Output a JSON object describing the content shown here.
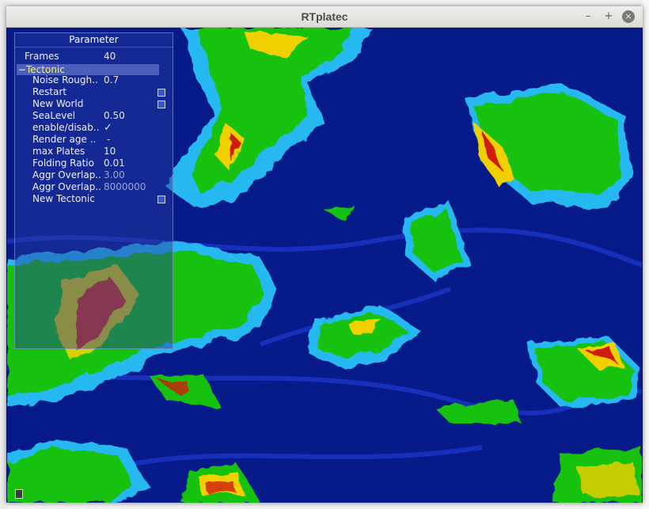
{
  "window": {
    "title": "RTplatec",
    "buttons": {
      "minimize": "–",
      "maximize": "+",
      "close": "×"
    }
  },
  "panel": {
    "title": "Parameter",
    "frames": {
      "label": "Frames",
      "value": "40"
    },
    "group": {
      "label": "Tectonic",
      "toggle": "−"
    },
    "items": [
      {
        "label": "Noise Rough..",
        "value": "0.7"
      },
      {
        "label": "Restart",
        "checkbox": true
      },
      {
        "label": "New World",
        "checkbox": true
      },
      {
        "label": "SeaLevel",
        "value": "0.50"
      },
      {
        "label": "enable/disab..",
        "value": "✓"
      },
      {
        "label": "Render age ..",
        "value": "-"
      },
      {
        "label": "max Plates",
        "value": "10"
      },
      {
        "label": "Folding Ratio",
        "value": "0.01"
      },
      {
        "label": "Aggr Overlap..",
        "value": "3.00"
      },
      {
        "label": "Aggr Overlap..",
        "value": "8000000"
      },
      {
        "label": "New Tectonic",
        "checkbox": true
      }
    ]
  },
  "colors": {
    "ocean_deep": "#071a8a",
    "ocean_shallow": "#1a3fe0",
    "shelf": "#26b8f0",
    "lowland": "#17c20e",
    "highland": "#f0d000",
    "peak": "#d01a10"
  }
}
